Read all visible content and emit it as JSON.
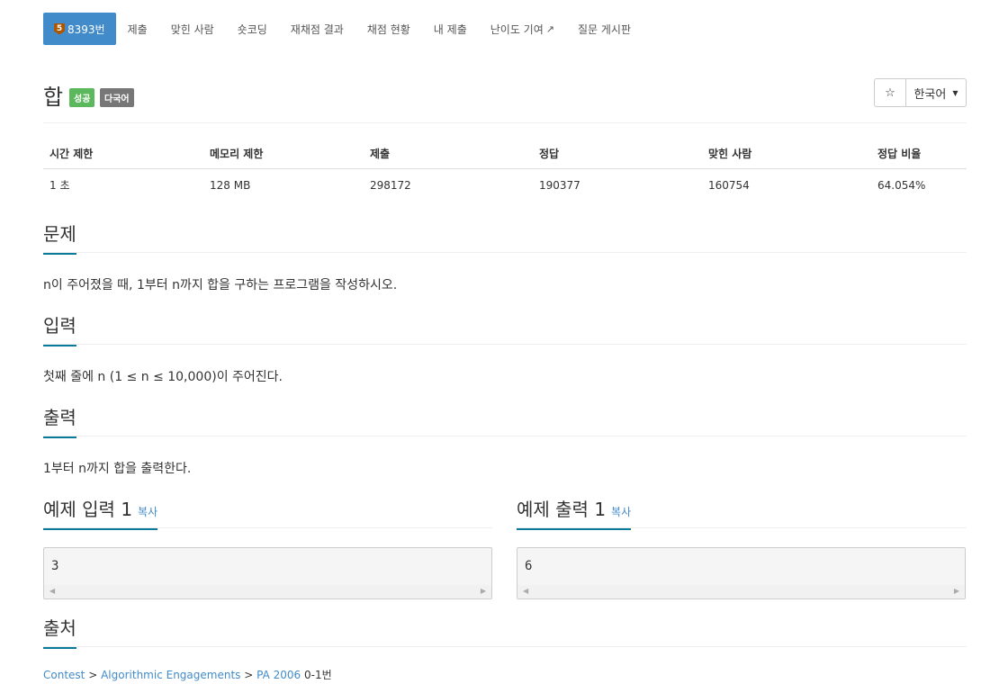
{
  "nav": {
    "problem_tier_number": "5",
    "problem_label": "8393번",
    "items": [
      "제출",
      "맞힌 사람",
      "숏코딩",
      "재채점 결과",
      "채점 현황",
      "내 제출",
      "난이도 기여",
      "질문 게시판"
    ]
  },
  "problem": {
    "title": "합",
    "badge_success": "성공",
    "badge_multilang": "다국어",
    "star": "☆",
    "language": "한국어"
  },
  "info": {
    "headers": [
      "시간 제한",
      "메모리 제한",
      "제출",
      "정답",
      "맞힌 사람",
      "정답 비율"
    ],
    "values": [
      "1 초",
      "128 MB",
      "298172",
      "190377",
      "160754",
      "64.054%"
    ]
  },
  "sections": {
    "problem_title": "문제",
    "problem_text": "n이 주어졌을 때, 1부터 n까지 합을 구하는 프로그램을 작성하시오.",
    "input_title": "입력",
    "input_text": "첫째 줄에 n (1 ≤ n ≤ 10,000)이 주어진다.",
    "output_title": "출력",
    "output_text": "1부터 n까지 합을 출력한다.",
    "sample_input_title": "예제 입력 1",
    "sample_output_title": "예제 출력 1",
    "copy": "복사",
    "sample_input_value": "3",
    "sample_output_value": "6",
    "source_title": "출처"
  },
  "source": {
    "crumb1": "Contest",
    "sep": ">",
    "crumb2": "Algorithmic Engagements",
    "crumb3": "PA 2006",
    "suffix": "0-1번"
  },
  "colors": {
    "accent": "#428bca",
    "success": "#5cb85c",
    "underline": "#0a7a9a"
  }
}
